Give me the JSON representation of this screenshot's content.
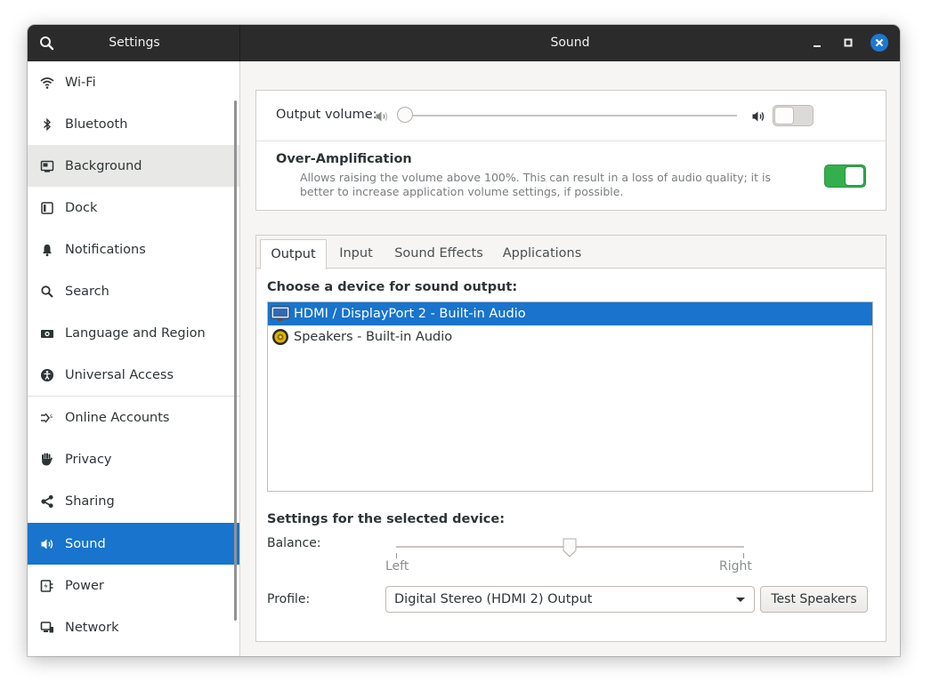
{
  "titlebar": {
    "left_title": "Settings",
    "title": "Sound"
  },
  "sidebar": {
    "items": [
      {
        "label": "Wi-Fi",
        "icon": "wifi-icon"
      },
      {
        "label": "Bluetooth",
        "icon": "bluetooth-icon"
      },
      {
        "label": "Background",
        "icon": "background-icon"
      },
      {
        "label": "Dock",
        "icon": "dock-icon"
      },
      {
        "label": "Notifications",
        "icon": "bell-icon"
      },
      {
        "label": "Search",
        "icon": "search-icon"
      },
      {
        "label": "Language and Region",
        "icon": "camera-icon"
      },
      {
        "label": "Universal Access",
        "icon": "accessibility-icon"
      },
      {
        "label": "Online Accounts",
        "icon": "online-accounts-icon"
      },
      {
        "label": "Privacy",
        "icon": "hand-icon"
      },
      {
        "label": "Sharing",
        "icon": "share-icon"
      },
      {
        "label": "Sound",
        "icon": "speaker-icon"
      },
      {
        "label": "Power",
        "icon": "power-icon"
      },
      {
        "label": "Network",
        "icon": "network-icon"
      }
    ],
    "active_item": "Sound",
    "hovered_item": "Background"
  },
  "output_volume": {
    "label": "Output volume:",
    "level_percent": 0,
    "mute_toggle_on": false
  },
  "over_amplification": {
    "title": "Over-Amplification",
    "description": "Allows raising the volume above 100%. This can result in a loss of audio quality; it is better to increase application volume settings, if possible.",
    "enabled": true
  },
  "tabs": [
    {
      "label": "Output"
    },
    {
      "label": "Input"
    },
    {
      "label": "Sound Effects"
    },
    {
      "label": "Applications"
    }
  ],
  "active_tab": "Output",
  "output": {
    "choose_title": "Choose a device for sound output:",
    "devices": [
      {
        "label": "HDMI / DisplayPort 2 - Built-in Audio",
        "icon": "monitor-icon",
        "selected": true
      },
      {
        "label": "Speakers - Built-in Audio",
        "icon": "speaker-device-icon",
        "selected": false
      }
    ],
    "settings_title": "Settings for the selected device:",
    "balance_label": "Balance:",
    "balance_left": "Left",
    "balance_right": "Right",
    "balance_value": 0.5,
    "profile_label": "Profile:",
    "profile_value": "Digital Stereo (HDMI 2) Output",
    "test_button": "Test Speakers"
  },
  "colors": {
    "accent": "#1874cd",
    "toggle_on": "#33b04d",
    "titlebar": "#2b2b2b"
  }
}
